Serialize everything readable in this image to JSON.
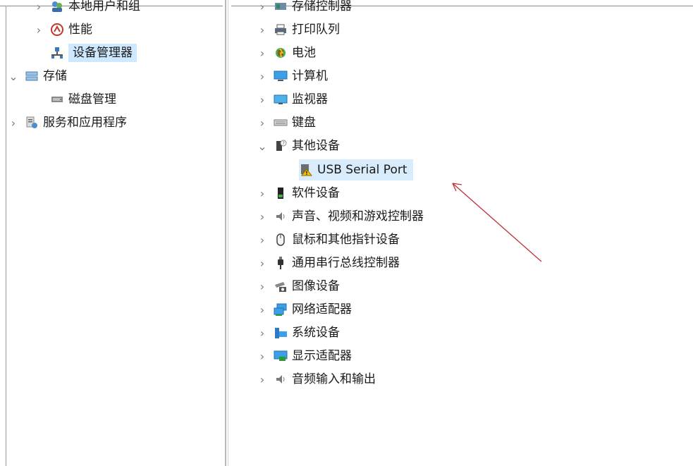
{
  "left_tree": {
    "items": [
      {
        "label": "本地用户和组",
        "icon": "users-icon",
        "chevron": "›"
      },
      {
        "label": "性能",
        "icon": "performance-icon",
        "chevron": "›"
      },
      {
        "label": "设备管理器",
        "icon": "device-manager-icon",
        "chevron": ""
      },
      {
        "label": "存储",
        "icon": "storage-icon",
        "chevron": "⌄"
      },
      {
        "label": "磁盘管理",
        "icon": "disk-management-icon",
        "chevron": ""
      },
      {
        "label": "服务和应用程序",
        "icon": "services-icon",
        "chevron": "›"
      }
    ]
  },
  "right_tree": {
    "items": [
      {
        "label": "存储控制器",
        "icon": "storage-controller-icon",
        "chevron": "›"
      },
      {
        "label": "打印队列",
        "icon": "printer-icon",
        "chevron": "›"
      },
      {
        "label": "电池",
        "icon": "battery-icon",
        "chevron": "›"
      },
      {
        "label": "计算机",
        "icon": "computer-icon",
        "chevron": "›"
      },
      {
        "label": "监视器",
        "icon": "monitor-icon",
        "chevron": "›"
      },
      {
        "label": "键盘",
        "icon": "keyboard-icon",
        "chevron": "›"
      },
      {
        "label": "其他设备",
        "icon": "unknown-device-icon",
        "chevron": "⌄"
      },
      {
        "label": "USB Serial Port",
        "icon": "warning-device-icon",
        "chevron": ""
      },
      {
        "label": "软件设备",
        "icon": "software-device-icon",
        "chevron": "›"
      },
      {
        "label": "声音、视频和游戏控制器",
        "icon": "speaker-icon",
        "chevron": "›"
      },
      {
        "label": "鼠标和其他指针设备",
        "icon": "mouse-icon",
        "chevron": "›"
      },
      {
        "label": "通用串行总线控制器",
        "icon": "usb-icon",
        "chevron": "›"
      },
      {
        "label": "图像设备",
        "icon": "camera-icon",
        "chevron": "›"
      },
      {
        "label": "网络适配器",
        "icon": "network-adapter-icon",
        "chevron": "›"
      },
      {
        "label": "系统设备",
        "icon": "system-device-icon",
        "chevron": "›"
      },
      {
        "label": "显示适配器",
        "icon": "display-adapter-icon",
        "chevron": "›"
      },
      {
        "label": "音频输入和输出",
        "icon": "audio-io-icon",
        "chevron": "›"
      }
    ]
  },
  "colors": {
    "selection": "#cde8ff",
    "highlight": "#d9ecfb",
    "annotation_arrow": "#c0303a"
  }
}
